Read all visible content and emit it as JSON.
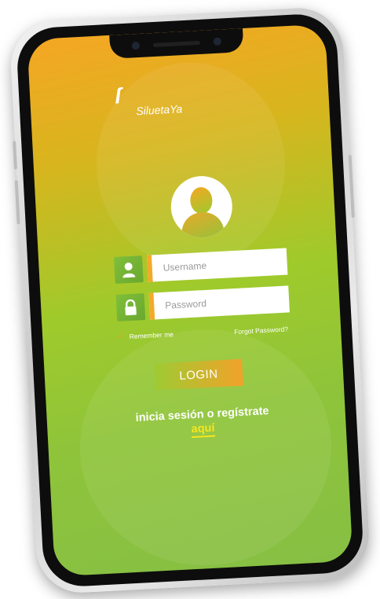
{
  "app": {
    "logo_text": "SiluetaYa"
  },
  "login_form": {
    "username_placeholder": "Username",
    "password_placeholder": "Password",
    "remember_label": "Remember me",
    "forgot_label": "Forgot Password?",
    "login_label": "LOGIN"
  },
  "signup": {
    "text": "inicia sesión o regístrate",
    "link_label": "aquí"
  },
  "icons": {
    "user_field_icon": "user-icon",
    "password_field_icon": "lock-icon",
    "remember_check_icon": "checkmark-icon"
  },
  "colors": {
    "accent_orange": "#f5a623",
    "accent_green": "#8fc43a",
    "link_yellow": "#f5e71d"
  }
}
